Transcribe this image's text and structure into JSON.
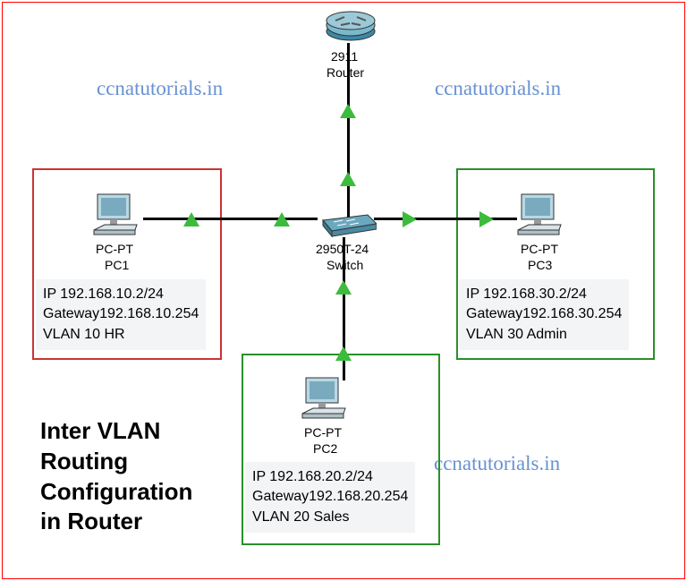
{
  "watermarks": {
    "top_left": "ccnatutorials.in",
    "top_right": "ccnatutorials.in",
    "bottom_right": "ccnatutorials.in"
  },
  "title": "Inter VLAN\nRouting\nConfiguration\nin Router",
  "devices": {
    "router": {
      "model": "2911",
      "label": "Router"
    },
    "switch": {
      "model": "2950T-24",
      "label": "Switch"
    },
    "pc1": {
      "type": "PC-PT",
      "name": "PC1",
      "ip": "IP 192.168.10.2/24",
      "gateway": "Gateway192.168.10.254",
      "vlan": "VLAN 10 HR"
    },
    "pc2": {
      "type": "PC-PT",
      "name": "PC2",
      "ip": "IP 192.168.20.2/24",
      "gateway": "Gateway192.168.20.254",
      "vlan": "VLAN 20 Sales"
    },
    "pc3": {
      "type": "PC-PT",
      "name": "PC3",
      "ip": "IP 192.168.30.2/24",
      "gateway": "Gateway192.168.30.254",
      "vlan": "VLAN 30 Admin"
    }
  }
}
